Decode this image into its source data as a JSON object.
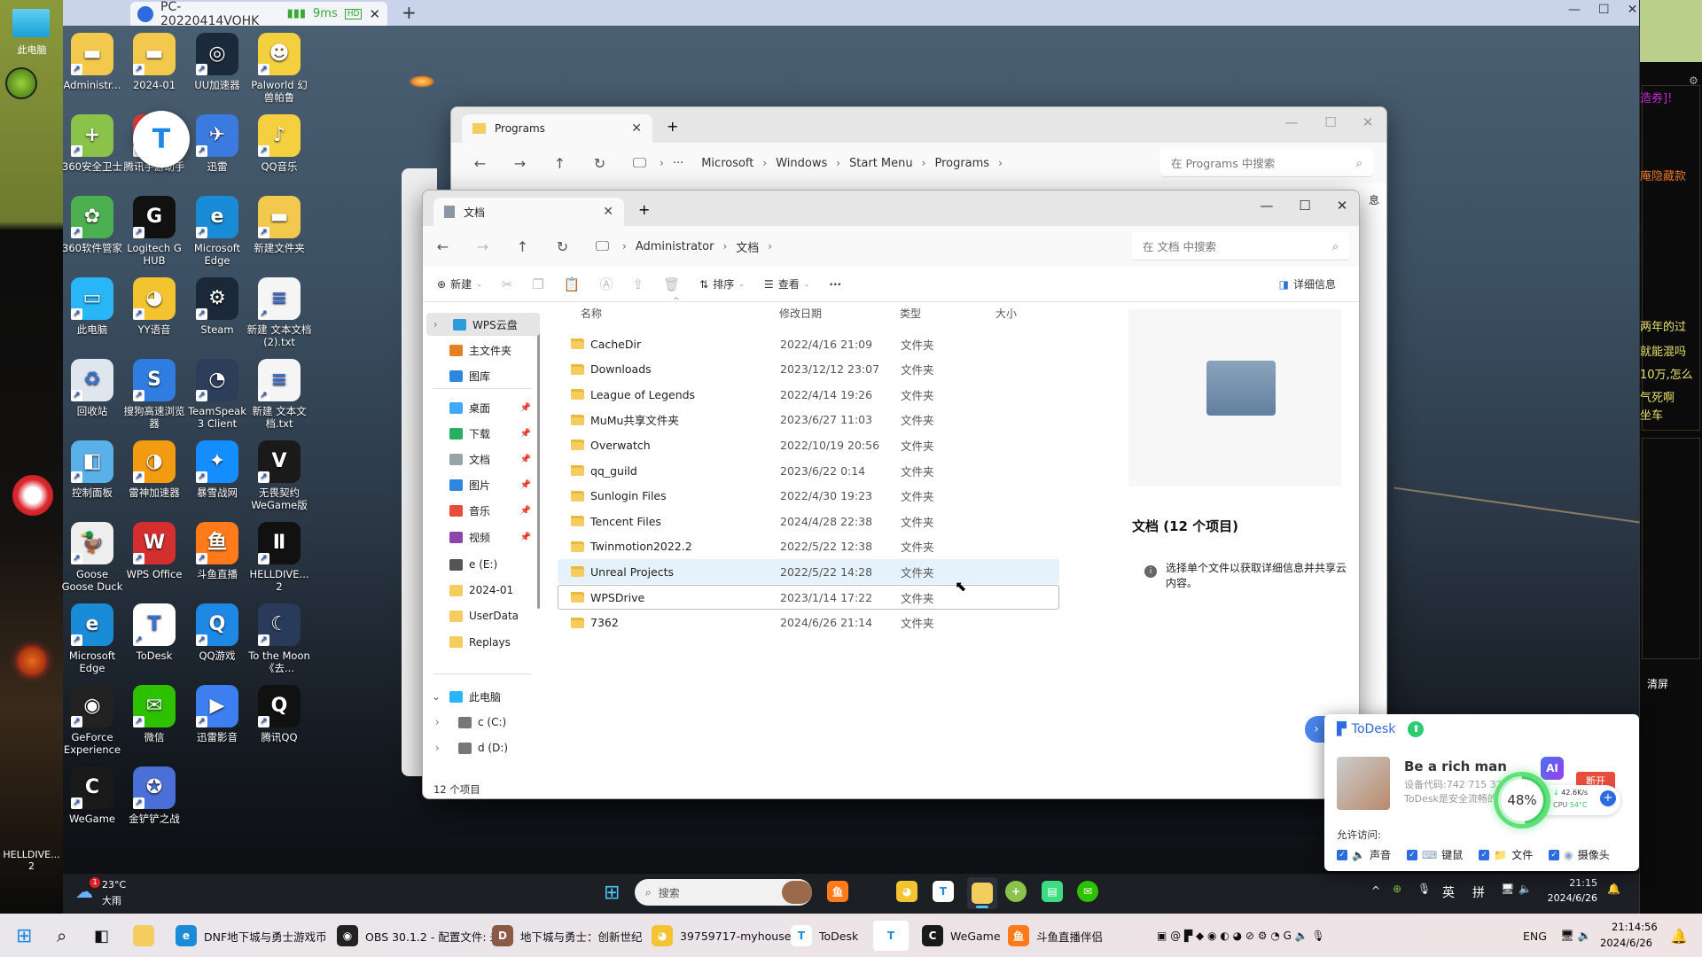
{
  "remote_session": {
    "title": "PC-20220414VOHK",
    "latency": "9ms",
    "quality_badge": "HD",
    "host_desktop_label": "此电脑",
    "host_desktop_label2": "HELLDIVE... 2"
  },
  "desktop_icons": [
    {
      "label": "Administr...",
      "color": "#f2c94c",
      "glyph": "▬"
    },
    {
      "label": "2024-01",
      "color": "#f2c94c",
      "glyph": "▬"
    },
    {
      "label": "UU加速器",
      "color": "#1b2a3a",
      "glyph": "◎"
    },
    {
      "label": "Palworld 幻兽帕鲁",
      "color": "#f4d03f",
      "glyph": "☻"
    },
    {
      "label": "360安全卫士",
      "color": "#8bc34a",
      "glyph": "+"
    },
    {
      "label": "腾讯手游助手",
      "color": "#e53935",
      "glyph": "◐"
    },
    {
      "label": "迅雷",
      "color": "#3b7be0",
      "glyph": "✈"
    },
    {
      "label": "QQ音乐",
      "color": "#f4d03f",
      "glyph": "♪"
    },
    {
      "label": "360软件管家",
      "color": "#4caf50",
      "glyph": "✿"
    },
    {
      "label": "Logitech G HUB",
      "color": "#111111",
      "glyph": "G"
    },
    {
      "label": "Microsoft Edge",
      "color": "#1a8bd6",
      "glyph": "e"
    },
    {
      "label": "新建文件夹",
      "color": "#f2c94c",
      "glyph": "▬"
    },
    {
      "label": "此电脑",
      "color": "#29b6f6",
      "glyph": "▭"
    },
    {
      "label": "YY语音",
      "color": "#f4c430",
      "glyph": "◕"
    },
    {
      "label": "Steam",
      "color": "#1b2838",
      "glyph": "⚙"
    },
    {
      "label": "新建 文本文档 (2).txt",
      "color": "#f5f5f5",
      "glyph": "≡"
    },
    {
      "label": "回收站",
      "color": "#dfe6ee",
      "glyph": "♻"
    },
    {
      "label": "搜狗高速浏览器",
      "color": "#2f7de1",
      "glyph": "S"
    },
    {
      "label": "TeamSpeak 3 Client",
      "color": "#2c3e5a",
      "glyph": "◔"
    },
    {
      "label": "新建 文本文档.txt",
      "color": "#f5f5f5",
      "glyph": "≡"
    },
    {
      "label": "控制面板",
      "color": "#5ab0e8",
      "glyph": "◧"
    },
    {
      "label": "雷神加速器",
      "color": "#f39c12",
      "glyph": "◑"
    },
    {
      "label": "暴雪战网",
      "color": "#148eff",
      "glyph": "✦"
    },
    {
      "label": "无畏契约WeGame版",
      "color": "#1a1a1a",
      "glyph": "V"
    },
    {
      "label": "Goose Goose Duck",
      "color": "#eeeeee",
      "glyph": "🦆"
    },
    {
      "label": "WPS Office",
      "color": "#d32f2f",
      "glyph": "W"
    },
    {
      "label": "斗鱼直播",
      "color": "#ff7a1a",
      "glyph": "鱼"
    },
    {
      "label": "HELLDIVE... 2",
      "color": "#111111",
      "glyph": "Ⅱ"
    },
    {
      "label": "Microsoft Edge",
      "color": "#1a8bd6",
      "glyph": "e"
    },
    {
      "label": "ToDesk",
      "color": "#ffffff",
      "glyph": "T"
    },
    {
      "label": "QQ游戏",
      "color": "#1e88e5",
      "glyph": "Q"
    },
    {
      "label": "To the Moon《去...",
      "color": "#2a3a5a",
      "glyph": "☾"
    },
    {
      "label": "GeForce Experience",
      "color": "#222222",
      "glyph": "◉"
    },
    {
      "label": "微信",
      "color": "#2dc100",
      "glyph": "✉"
    },
    {
      "label": "迅雷影音",
      "color": "#3d7ef0",
      "glyph": "▶"
    },
    {
      "label": "腾讯QQ",
      "color": "#111111",
      "glyph": "Q"
    },
    {
      "label": "WeGame",
      "color": "#1a1a1a",
      "glyph": "C"
    },
    {
      "label": "金铲铲之战",
      "color": "#4a6fd6",
      "glyph": "✪"
    }
  ],
  "programs_window": {
    "tab_title": "Programs",
    "breadcrumb": [
      "Microsoft",
      "Windows",
      "Start Menu",
      "Programs"
    ],
    "search_placeholder": "在 Programs 中搜索",
    "peek_text": "息"
  },
  "documents_window": {
    "tab_title": "文档",
    "breadcrumb": [
      "Administrator",
      "文档"
    ],
    "search_placeholder": "在 文档 中搜索",
    "toolbar": {
      "new": "新建",
      "sort": "排序",
      "view": "查看",
      "more": "···",
      "details": "详细信息"
    },
    "sidebar": {
      "top": [
        {
          "label": "WPS云盘",
          "color": "#2d9cdb"
        },
        {
          "label": "主文件夹",
          "color": "#e67e22"
        },
        {
          "label": "图库",
          "color": "#2e86de"
        }
      ],
      "pinned": [
        {
          "label": "桌面",
          "color": "#3fa9f5"
        },
        {
          "label": "下载",
          "color": "#27ae60"
        },
        {
          "label": "文档",
          "color": "#95a5a6"
        },
        {
          "label": "图片",
          "color": "#2e86de"
        },
        {
          "label": "音乐",
          "color": "#e74c3c"
        },
        {
          "label": "视频",
          "color": "#8e44ad"
        }
      ],
      "other": [
        {
          "label": "e (E:)",
          "color": "#555555"
        },
        {
          "label": "2024-01",
          "color": "#f4cd5e"
        },
        {
          "label": "UserData",
          "color": "#f4cd5e"
        },
        {
          "label": "Replays",
          "color": "#f4cd5e"
        }
      ],
      "this_pc": {
        "label": "此电脑",
        "drives": [
          "c (C:)",
          "d (D:)"
        ]
      }
    },
    "columns": [
      "名称",
      "修改日期",
      "类型",
      "大小"
    ],
    "files": [
      {
        "name": "CacheDir",
        "date": "2022/4/16 21:09",
        "type": "文件夹"
      },
      {
        "name": "Downloads",
        "date": "2023/12/12 23:07",
        "type": "文件夹"
      },
      {
        "name": "League of Legends",
        "date": "2022/4/14 19:26",
        "type": "文件夹"
      },
      {
        "name": "MuMu共享文件夹",
        "date": "2023/6/27 11:03",
        "type": "文件夹"
      },
      {
        "name": "Overwatch",
        "date": "2022/10/19 20:56",
        "type": "文件夹"
      },
      {
        "name": "qq_guild",
        "date": "2023/6/22 0:14",
        "type": "文件夹"
      },
      {
        "name": "Sunlogin Files",
        "date": "2022/4/30 19:23",
        "type": "文件夹"
      },
      {
        "name": "Tencent Files",
        "date": "2024/4/28 22:38",
        "type": "文件夹"
      },
      {
        "name": "Twinmotion2022.2",
        "date": "2022/5/22 12:38",
        "type": "文件夹"
      },
      {
        "name": "Unreal Projects",
        "date": "2022/5/22 14:28",
        "type": "文件夹",
        "state": "hover"
      },
      {
        "name": "WPSDrive",
        "date": "2023/1/14 17:22",
        "type": "文件夹",
        "state": "focused"
      },
      {
        "name": "7362",
        "date": "2024/6/26 21:14",
        "type": "文件夹"
      }
    ],
    "detail_title": "文档 (12 个项目)",
    "detail_hint": "选择单个文件以获取详细信息并共享云内容。",
    "status": "12 个项目"
  },
  "remote_taskbar": {
    "weather_temp": "23°C",
    "weather_desc": "大雨",
    "weather_badge": "1",
    "search_placeholder": "搜索",
    "ime_lang": "英",
    "ime_mode": "拼",
    "time": "21:15",
    "date": "2024/6/26"
  },
  "todesk_panel": {
    "brand": "ToDesk",
    "name": "Be a rich man",
    "device_code": "设备代码:742 715 32",
    "tagline": "ToDesk是安全流畅的远",
    "ai_badge": "AI",
    "disconnect": "断开",
    "gauge_percent": 48,
    "gauge_label": "48%",
    "speed": "42.6K/s",
    "cpu_label": "CPU",
    "cpu_temp": "54°C",
    "allow_label": "允许访问:",
    "permissions": [
      {
        "label": "声音",
        "checked": true
      },
      {
        "label": "键鼠",
        "checked": true
      },
      {
        "label": "文件",
        "checked": true
      },
      {
        "label": "摄像头",
        "checked": true
      }
    ]
  },
  "host_taskbar": {
    "items": [
      {
        "label": "DNF地下城与勇士游戏币",
        "color": "#1a8bd6",
        "glyph": "e"
      },
      {
        "label": "OBS 30.1.2 - 配置文件: 未",
        "color": "#222222",
        "glyph": "◉"
      },
      {
        "label": "地下城与勇士：创新世纪",
        "color": "#8a5a44",
        "glyph": "D"
      },
      {
        "label": "39759717-myhouse",
        "color": "#f4c430",
        "glyph": "◕"
      },
      {
        "label": "ToDesk",
        "color": "#ffffff",
        "glyph": "T"
      },
      {
        "label": "",
        "color": "#ffffff",
        "glyph": "T"
      },
      {
        "label": "WeGame",
        "color": "#1a1a1a",
        "glyph": "C"
      },
      {
        "label": "斗鱼直播伴侣",
        "color": "#ff7a1a",
        "glyph": "鱼"
      }
    ],
    "lang": "ENG",
    "time": "21:14:56",
    "date": "2024/6/26"
  },
  "game_chat": {
    "lines": [
      {
        "text": "造券]!",
        "color": "#c02bd6"
      },
      {
        "text": "庵隐藏款",
        "color": "#e0762a"
      },
      {
        "text": "两年的过",
        "color": "#e8e070"
      },
      {
        "text": "就能混吗",
        "color": "#e8e070"
      },
      {
        "text": "10万,怎么",
        "color": "#e8e070"
      },
      {
        "text": "气死啊",
        "color": "#e8e070"
      },
      {
        "text": "坐车",
        "color": "#e8e070"
      }
    ],
    "clear": "清屏"
  }
}
